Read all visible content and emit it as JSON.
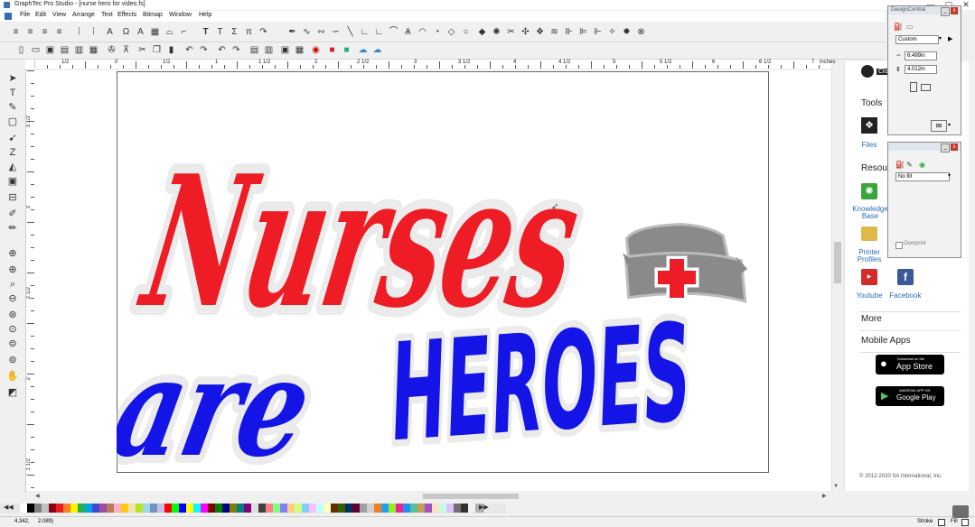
{
  "window": {
    "title": "GraphTec Pro Studio - [nurse hero for video.fs]",
    "min_glyph": "—",
    "max_glyph": "▢",
    "close_glyph": "✕"
  },
  "menu": {
    "items": [
      "File",
      "Edit",
      "View",
      "Arrange",
      "Text",
      "Effects",
      "Bitmap",
      "Window",
      "Help"
    ]
  },
  "ruler": {
    "unit_label": "inches",
    "labels": [
      "1/2",
      "0",
      "1/2",
      "1",
      "1 1/2",
      "2",
      "2 1/2",
      "3",
      "3 1/2",
      "4",
      "4 1/2",
      "5",
      "5 1/2",
      "6",
      "6 1/2",
      "7"
    ],
    "v_labels": [
      "3 1/2",
      "3",
      "2 1/2",
      "2",
      "1 1/2"
    ]
  },
  "artwork": {
    "line1": "Nurses",
    "line2a": "are",
    "line2b": "HEROES",
    "red": "#ee1c24",
    "blue": "#1414e6",
    "gray": "#8a8a8a"
  },
  "side_panel": {
    "header_partial": "Clo",
    "tools_heading": "Tools",
    "files_label": "Files",
    "resources_heading": "Resou",
    "knowledge_base_label": "Knowledge Base",
    "printer_profiles_label": "Printer Profiles",
    "youtube_label": "Youtube",
    "facebook_label": "Facebook",
    "more_label": "More",
    "mobile_apps_label": "Mobile Apps",
    "app_store_small": "Download on the",
    "app_store_big": "App Store",
    "google_play_small": "ANDROID APP ON",
    "google_play_big": "Google Play",
    "copyright": "© 2012-2020 SA International, Inc."
  },
  "design_central": {
    "title": "DesignCentral",
    "preset": "Custom",
    "width": "6.499in",
    "height": "4.012in"
  },
  "fill_window": {
    "fill_value": "No fill",
    "overprint_label": "Overprint"
  },
  "status": {
    "coords_x": "4.342,",
    "coords_y": "2.089)",
    "stroke_label": "Stroke",
    "fill_label": "Fill"
  },
  "palette_colors": [
    "#ffffff",
    "#000000",
    "#7f7f7f",
    "#c0c0c0",
    "#880015",
    "#ed1c24",
    "#ff7f27",
    "#fff200",
    "#22b14c",
    "#00a2e8",
    "#3f48cc",
    "#a349a4",
    "#b97a57",
    "#ffaec9",
    "#ffc90e",
    "#efe4b0",
    "#b5e61d",
    "#99d9ea",
    "#7092be",
    "#c8bfe7",
    "#ff0000",
    "#00ff00",
    "#0000ff",
    "#ffff00",
    "#00ffff",
    "#ff00ff",
    "#800000",
    "#008000",
    "#000080",
    "#808000",
    "#008080",
    "#800080",
    "#e0e0e0",
    "#404040",
    "#ff8080",
    "#80ff80",
    "#8080ff",
    "#ffd080",
    "#d0ff80",
    "#80d0ff",
    "#ffc0ff",
    "#c0ffff",
    "#ffffc0",
    "#603000",
    "#306000",
    "#003060",
    "#600030",
    "#a0a0a0",
    "#d0d0d0",
    "#f08020",
    "#20a0f0",
    "#90f020",
    "#f02090",
    "#2090f0",
    "#50c0a0",
    "#c0a050",
    "#a050c0",
    "#ffe0c0",
    "#c0ffe0",
    "#e0c0ff",
    "#707070",
    "#303030",
    "#f0f0f0",
    "#b0b0b0"
  ]
}
